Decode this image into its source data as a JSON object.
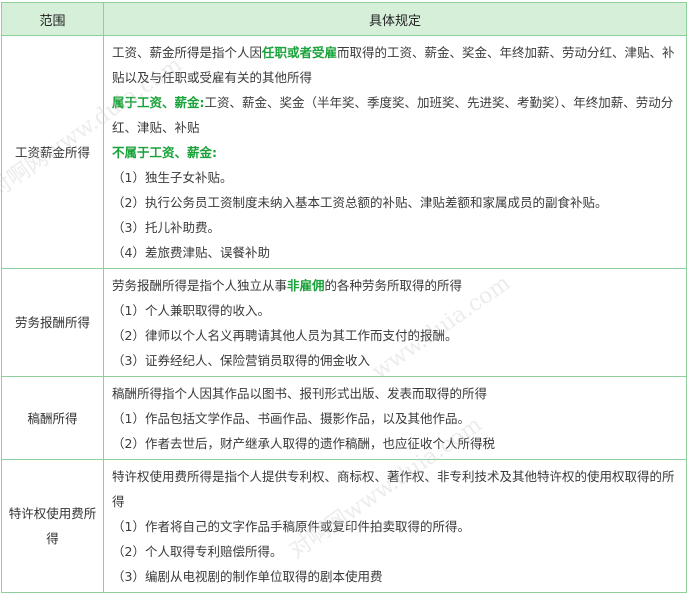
{
  "header": {
    "col1": "范围",
    "col2": "具体规定"
  },
  "rows": [
    {
      "category": "工资薪金所得",
      "lines": [
        {
          "parts": [
            {
              "t": "工资、薪金所得是指个人因"
            },
            {
              "t": "任职或者受雇",
              "hl": true
            },
            {
              "t": "而取得的工资、薪金、奖金、年终加薪、劳动分红、津贴、补贴以及与任职或受雇有关的其他所得"
            }
          ]
        },
        {
          "parts": [
            {
              "t": "属于工资、薪金:",
              "hl": true
            },
            {
              "t": "工资、薪金、奖金（半年奖、季度奖、加班奖、先进奖、考勤奖）、年终加薪、劳动分红、津贴、补贴"
            }
          ]
        },
        {
          "parts": [
            {
              "t": "不属于工资、薪金:",
              "hl": true
            }
          ]
        },
        {
          "parts": [
            {
              "t": "（1）独生子女补贴。"
            }
          ]
        },
        {
          "parts": [
            {
              "t": "（2）执行公务员工资制度未纳入基本工资总额的补贴、津贴差额和家属成员的副食补贴。"
            }
          ]
        },
        {
          "parts": [
            {
              "t": "（3）托儿补助费。"
            }
          ]
        },
        {
          "parts": [
            {
              "t": "（4）差旅费津贴、误餐补助"
            }
          ]
        }
      ]
    },
    {
      "category": "劳务报酬所得",
      "lines": [
        {
          "parts": [
            {
              "t": "劳务报酬所得是指个人独立从事"
            },
            {
              "t": "非雇佣",
              "hl": true
            },
            {
              "t": "的各种劳务所取得的所得"
            }
          ]
        },
        {
          "parts": [
            {
              "t": "（1）个人兼职取得的收入。"
            }
          ]
        },
        {
          "parts": [
            {
              "t": "（2）律师以个人名义再聘请其他人员为其工作而支付的报酬。"
            }
          ]
        },
        {
          "parts": [
            {
              "t": "（3）证券经纪人、保险营销员取得的佣金收入"
            }
          ]
        }
      ]
    },
    {
      "category": "稿酬所得",
      "lines": [
        {
          "parts": [
            {
              "t": "稿酬所得指个人因其作品以图书、报刊形式出版、发表而取得的所得"
            }
          ]
        },
        {
          "parts": [
            {
              "t": "（1）作品包括文学作品、书画作品、摄影作品，以及其他作品。"
            }
          ]
        },
        {
          "parts": [
            {
              "t": "（2）作者去世后，财产继承人取得的遗作稿酬，也应征收个人所得税"
            }
          ]
        }
      ]
    },
    {
      "category": "特许权使用费所得",
      "lines": [
        {
          "parts": [
            {
              "t": "特许权使用费所得是指个人提供专利权、商标权、著作权、非专利技术及其他特许权的使用权取得的所得"
            }
          ]
        },
        {
          "parts": [
            {
              "t": "（1）作者将自己的文字作品手稿原件或复印件拍卖取得的所得。"
            }
          ]
        },
        {
          "parts": [
            {
              "t": "（2）个人取得专利赔偿所得。"
            }
          ]
        },
        {
          "parts": [
            {
              "t": "（3）编剧从电视剧的制作单位取得的剧本使用费"
            }
          ]
        }
      ]
    }
  ],
  "watermarks": [
    "对啊网www.duia.com",
    "www.duia.com",
    "对啊网www.duia.com"
  ]
}
